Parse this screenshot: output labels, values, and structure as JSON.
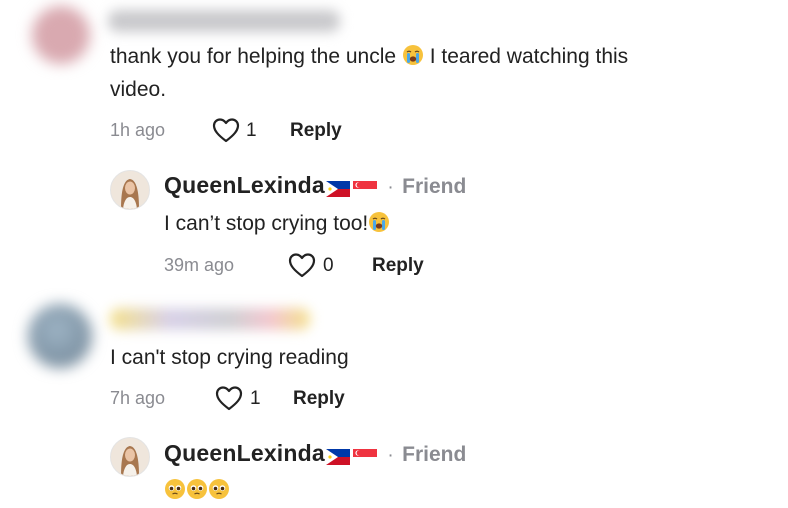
{
  "comments": [
    {
      "text_line1": "thank you for helping the uncle",
      "text_line1_after": "I teared watching this",
      "text_line2": "video.",
      "time": "1h ago",
      "likes": "1",
      "reply_label": "Reply",
      "reply": {
        "username": "QueenLexinda",
        "separator": "·",
        "badge": "Friend",
        "text": "I can’t stop crying too!",
        "time": "39m ago",
        "likes": "0",
        "reply_label": "Reply"
      }
    },
    {
      "text_line1": "I can't stop crying reading",
      "time": "7h ago",
      "likes": "1",
      "reply_label": "Reply",
      "reply": {
        "username": "QueenLexinda",
        "separator": "·",
        "badge": "Friend"
      }
    }
  ],
  "colors": {
    "text": "#222222",
    "muted": "#8a8b91"
  }
}
